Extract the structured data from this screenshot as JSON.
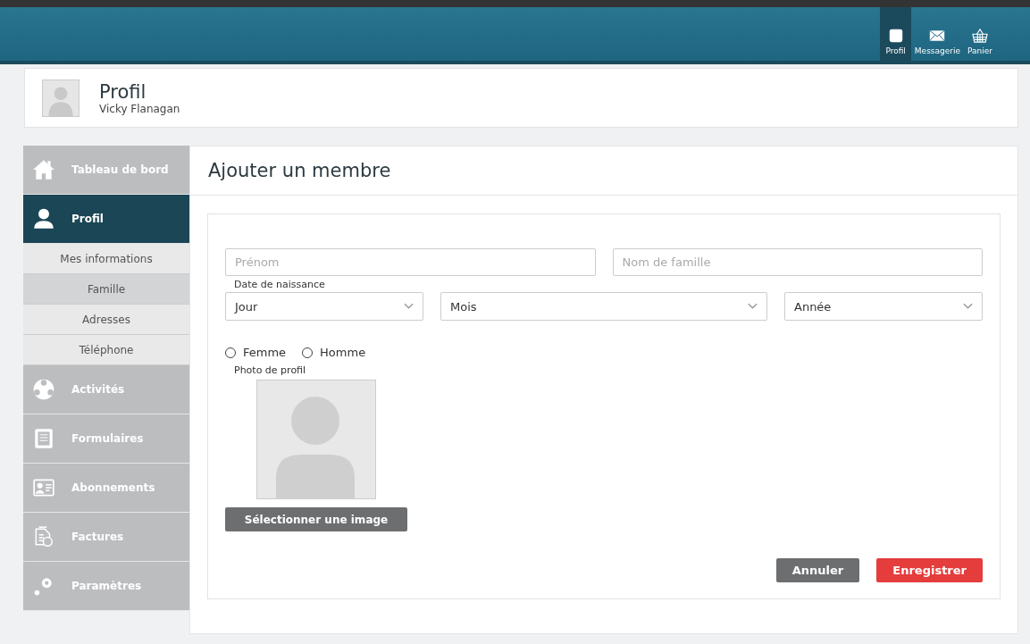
{
  "topbar": {
    "items": [
      {
        "label": "Profil",
        "selected": true
      },
      {
        "label": "Messagerie",
        "selected": false
      },
      {
        "label": "Panier",
        "selected": false
      }
    ]
  },
  "profile": {
    "title": "Profil",
    "name": "Vicky Flanagan"
  },
  "sidebar": {
    "items": [
      {
        "label": "Tableau de bord",
        "selected": false
      },
      {
        "label": "Profil",
        "selected": true,
        "expanded": true,
        "children": [
          {
            "label": "Mes informations",
            "selected": false
          },
          {
            "label": "Famille",
            "selected": true
          },
          {
            "label": "Adresses",
            "selected": false
          },
          {
            "label": "Téléphone",
            "selected": false
          }
        ]
      },
      {
        "label": "Activités",
        "selected": false
      },
      {
        "label": "Formulaires",
        "selected": false
      },
      {
        "label": "Abonnements",
        "selected": false
      },
      {
        "label": "Factures",
        "selected": false
      },
      {
        "label": "Paramètres",
        "selected": false
      }
    ]
  },
  "form": {
    "title": "Ajouter un membre",
    "first_name": {
      "placeholder": "Prénom"
    },
    "last_name": {
      "placeholder": "Nom de famille"
    },
    "birth_label": "Date de naissance",
    "birth_selects": [
      {
        "value": "Jour"
      },
      {
        "value": "Mois"
      },
      {
        "value": "Année"
      }
    ],
    "genders": [
      {
        "label": "Femme",
        "selected": false
      },
      {
        "label": "Homme",
        "selected": false
      }
    ],
    "photo_label": "Photo de profil",
    "select_image": "Sélectionner une image",
    "cancel": "Annuler",
    "save": "Enregistrer"
  }
}
